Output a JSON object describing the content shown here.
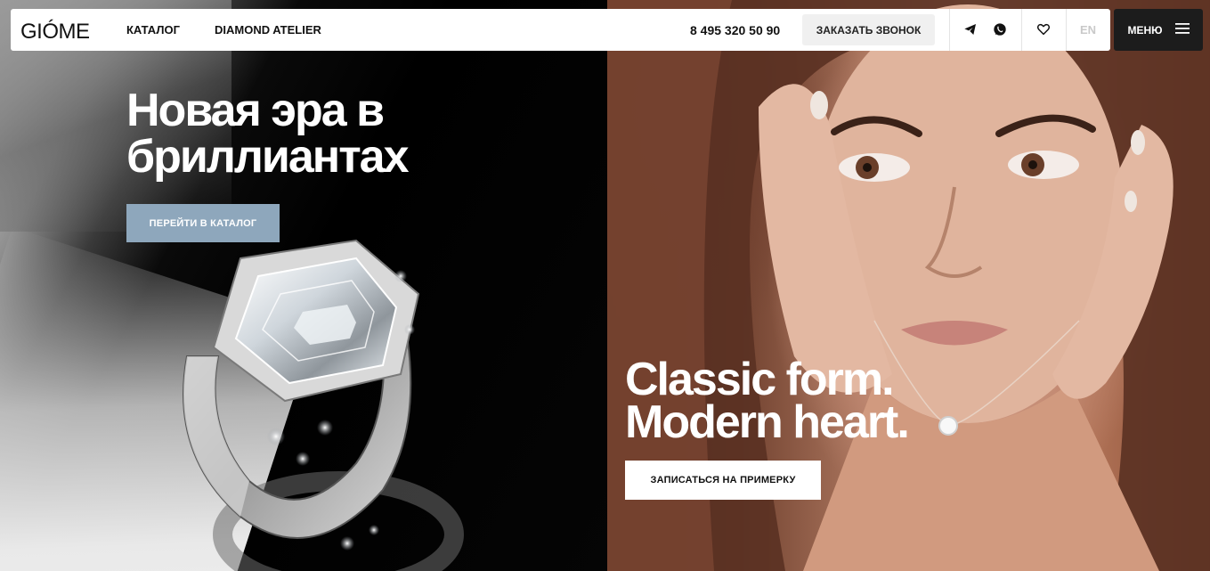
{
  "header": {
    "logo": "GIÓME",
    "nav": [
      {
        "label": "КАТАЛОГ"
      },
      {
        "label": "DIAMOND ATELIER"
      }
    ],
    "phone": "8 495 320 50 90",
    "callback_label": "ЗАКАЗАТЬ ЗВОНОК",
    "language": "EN",
    "menu_label": "МЕНЮ",
    "icons": [
      "telegram-icon",
      "whatsapp-icon",
      "heart-icon",
      "hamburger-icon"
    ]
  },
  "hero_left": {
    "title": "Новая эра в\nбриллиантах",
    "button_label": "ПЕРЕЙТИ В КАТАЛОГ",
    "button_color": "#8ea7bc"
  },
  "hero_right": {
    "title": "Classic form.\nModern heart.",
    "button_label": "ЗАПИСАТЬСЯ НА ПРИМЕРКУ"
  }
}
